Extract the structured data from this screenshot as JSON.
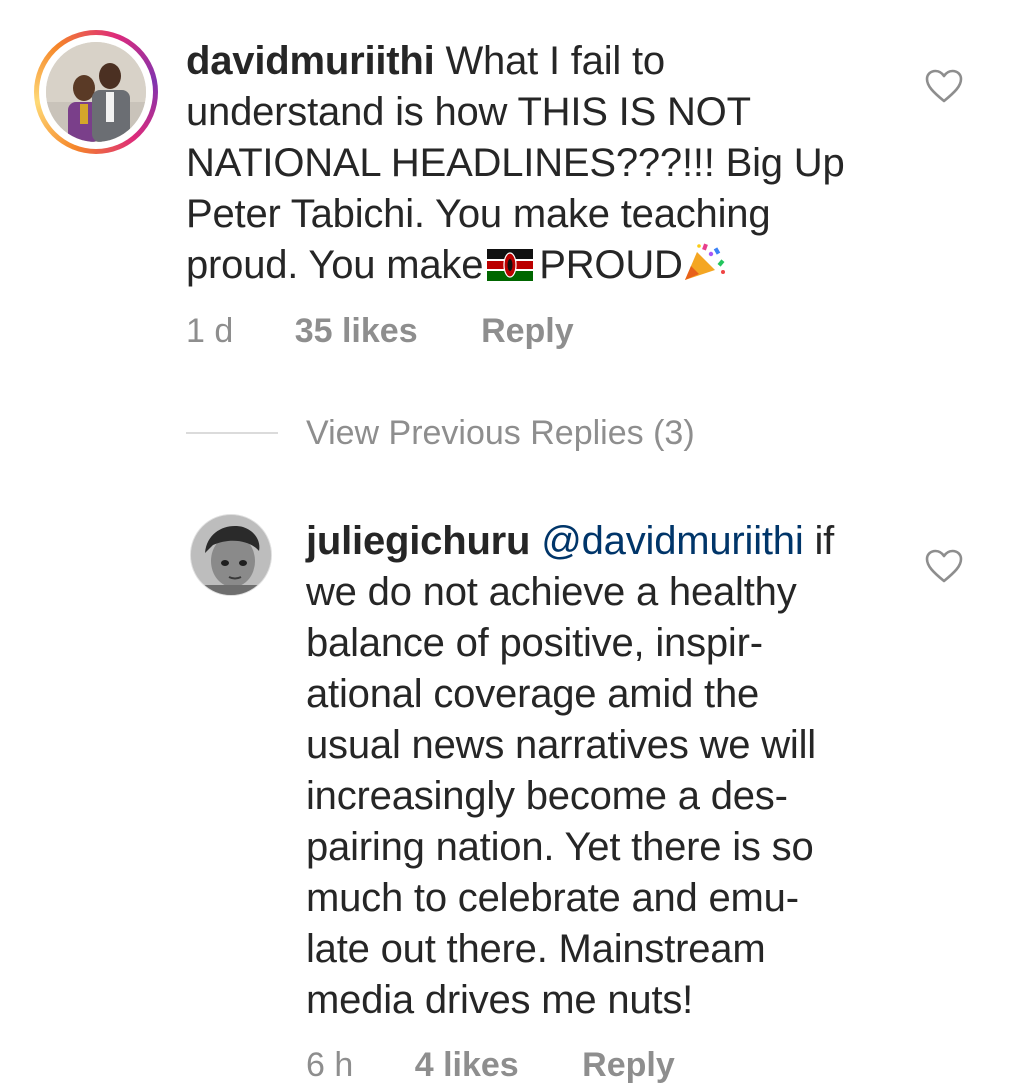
{
  "comments": [
    {
      "username": "davidmuriithi",
      "lines": [
        "What I fail to",
        "understand is how THIS IS NOT",
        "NATIONAL HEADLINES???!!! Big Up",
        "Peter Tabichi. You make teaching",
        "proud. You make",
        "PROUD"
      ],
      "flag_icon": "kenya-flag-emoji",
      "emoji_icon": "party-popper-emoji",
      "time": "1 d",
      "likes": "35 likes",
      "reply_label": "Reply"
    },
    {
      "username": "juliegichuru",
      "mention": "@davidmuriithi",
      "lines": [
        "if",
        "we do not achieve a healthy",
        "balance of positive, inspir-",
        "ational coverage amid the",
        "usual news narratives we will",
        "increasingly become a des-",
        "pairing nation. Yet there is so",
        "much to celebrate and emu-",
        "late out there. Mainstream",
        "media drives me nuts!"
      ],
      "time": "6 h",
      "likes": "4 likes",
      "reply_label": "Reply"
    }
  ],
  "view_previous_replies": "View Previous Replies (3)",
  "colors": {
    "text": "#262626",
    "muted": "#8e8e8e",
    "mention": "#003569",
    "divider": "#dbdbdb"
  }
}
